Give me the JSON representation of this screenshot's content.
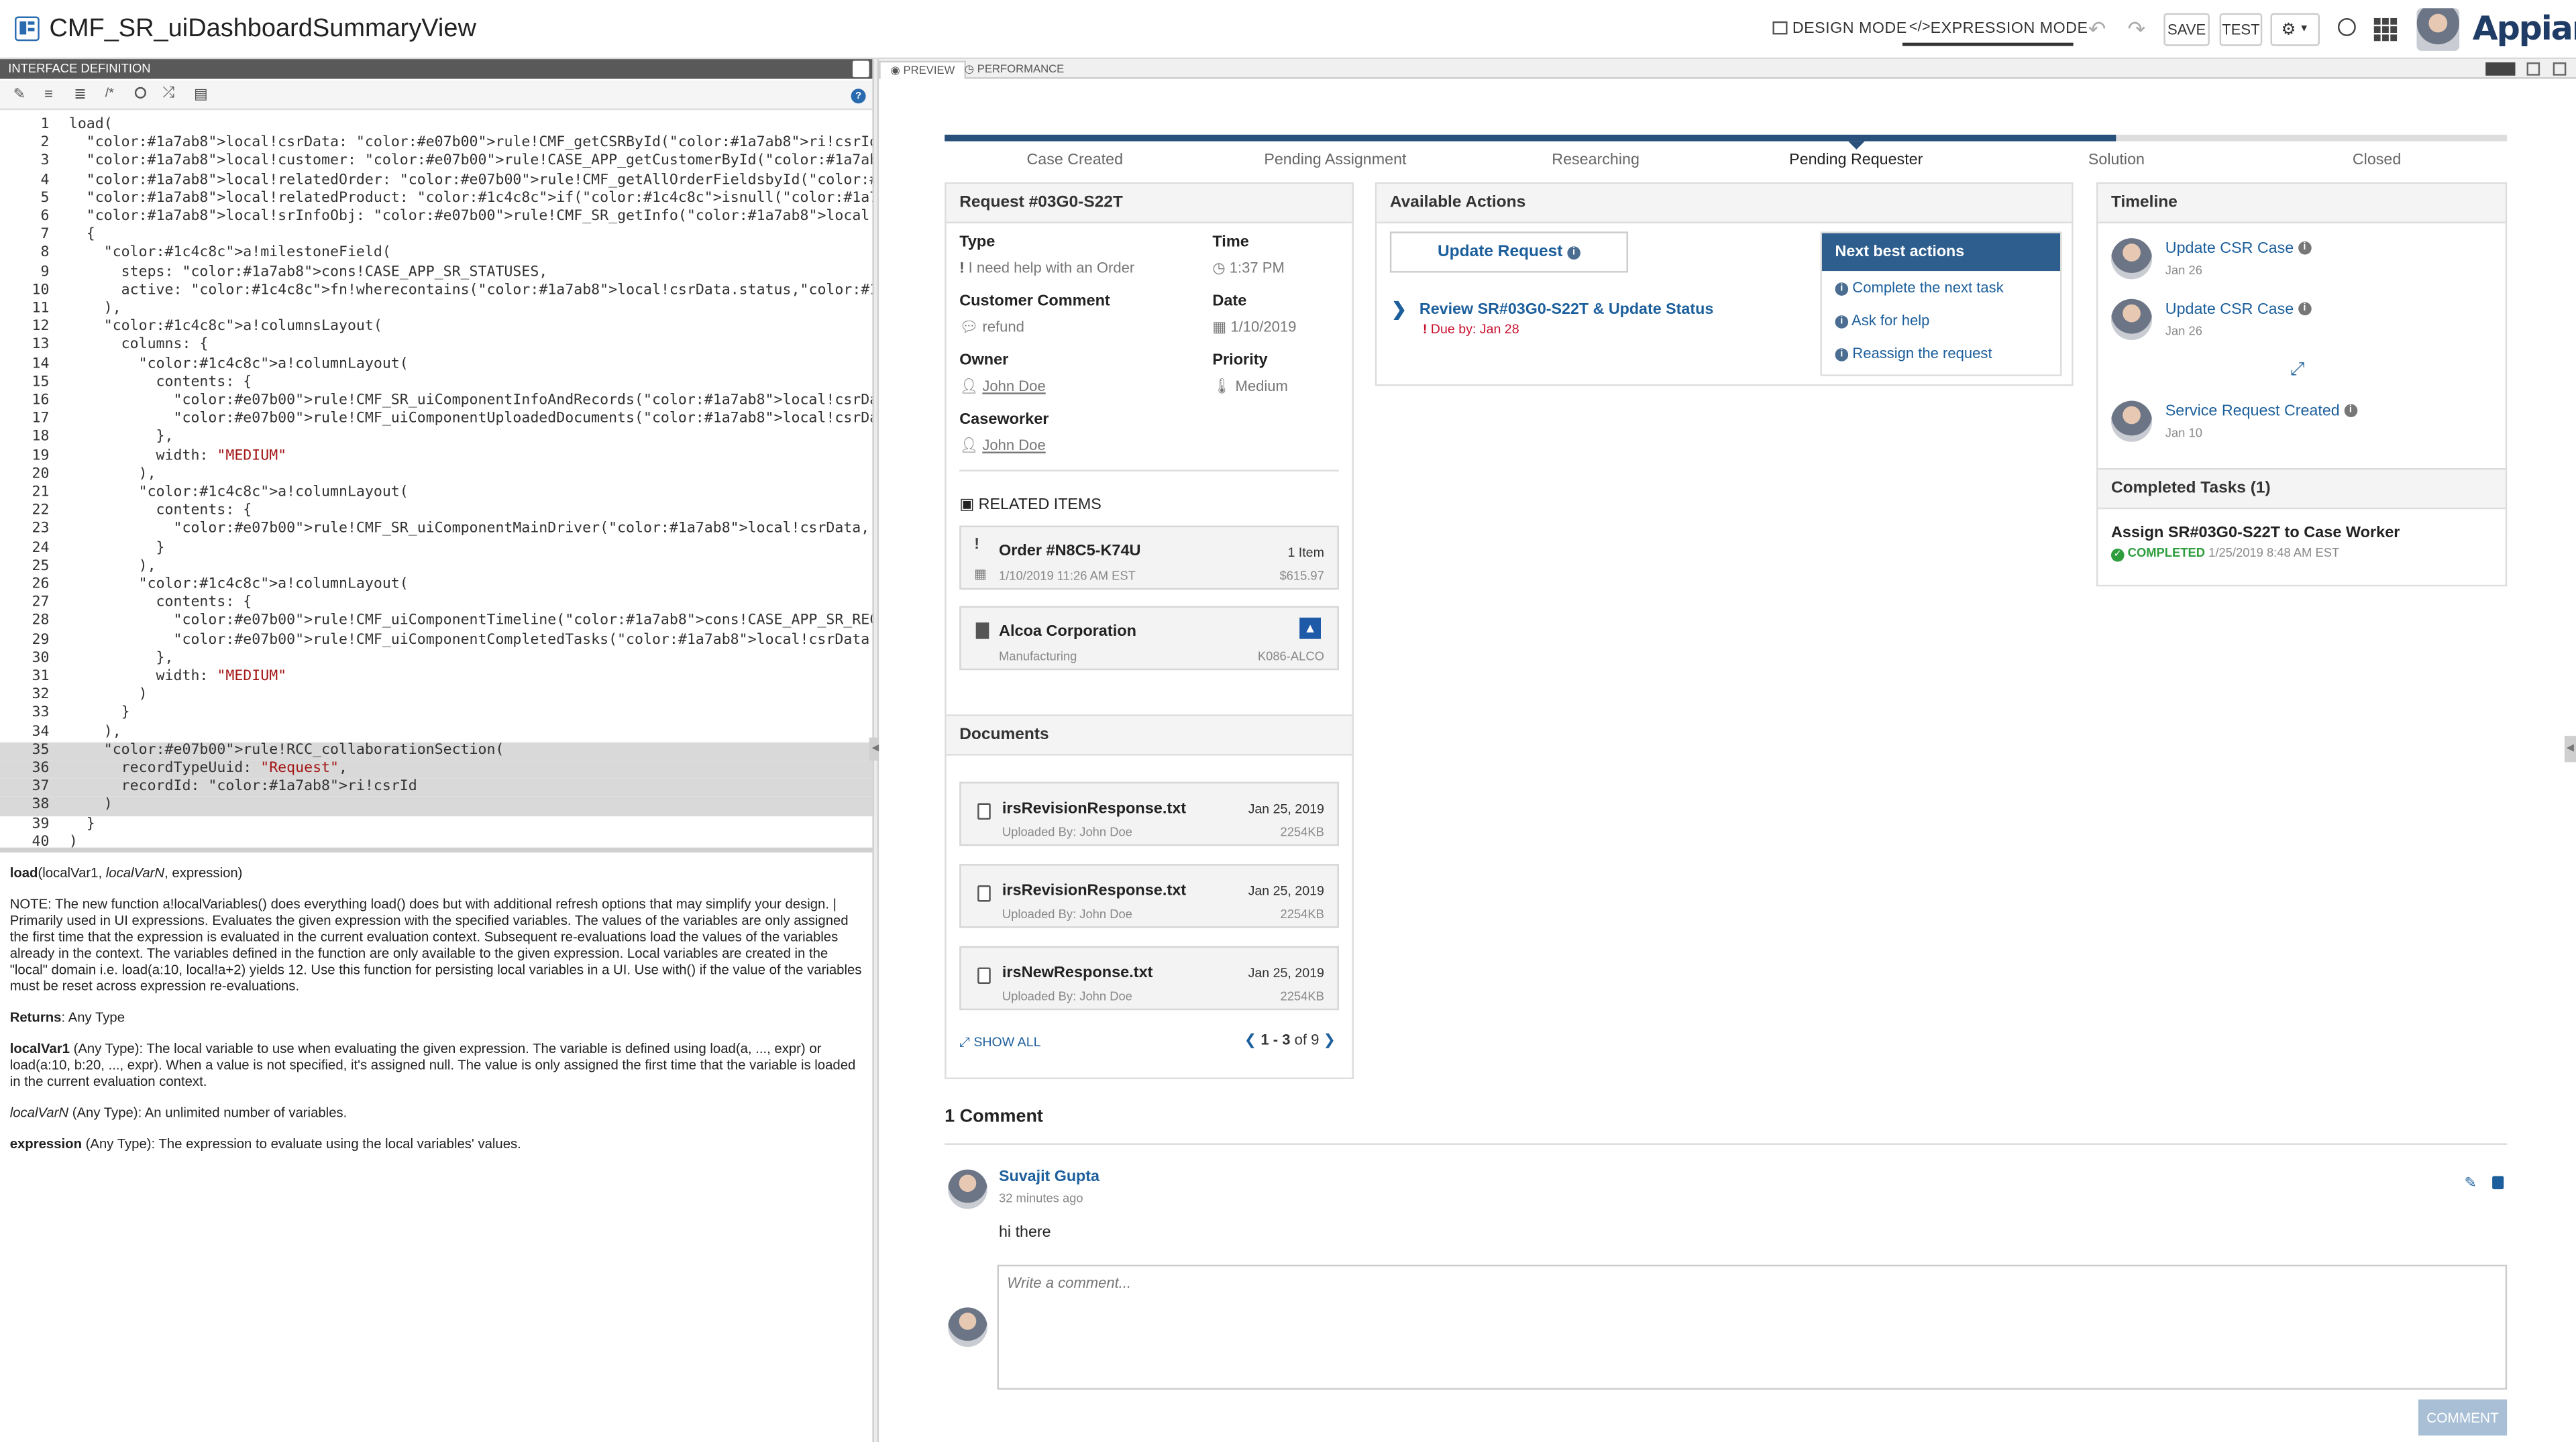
{
  "header": {
    "title": "CMF_SR_uiDashboardSummaryView",
    "design_mode": "DESIGN MODE",
    "expression_mode": "EXPRESSION MODE",
    "save": "SAVE",
    "test": "TEST",
    "logo": "Appian"
  },
  "left": {
    "title": "INTERFACE DEFINITION"
  },
  "code_lines": [
    {
      "n": "1",
      "t": "load("
    },
    {
      "n": "2",
      "t": "  local!csrData: rule!CMF_getCSRById(ri!csrId),"
    },
    {
      "n": "3",
      "t": "  local!customer: rule!CASE_APP_getCustomerById(local!csrData.relatedCustomerId),"
    },
    {
      "n": "4",
      "t": "  local!relatedOrder: rule!CMF_getAllOrderFieldsbyId(local!csrData.relatedOrderItemId),"
    },
    {
      "n": "5",
      "t": "  local!relatedProduct: if(isnull(local!csrData.relatedOrderItemId), null, rule!CMF_getOr"
    },
    {
      "n": "6",
      "t": "  local!srInfoObj: rule!CMF_SR_getInfo(local!csrData, local!customer, local!relatedOrder,"
    },
    {
      "n": "7",
      "t": "  {"
    },
    {
      "n": "8",
      "t": "    a!milestoneField("
    },
    {
      "n": "9",
      "t": "      steps: cons!CASE_APP_SR_STATUSES,"
    },
    {
      "n": "10",
      "t": "      active: fn!wherecontains(local!csrData.status,cons!CASE_APP_SR_STATUSES)"
    },
    {
      "n": "11",
      "t": "    ),"
    },
    {
      "n": "12",
      "t": "    a!columnsLayout("
    },
    {
      "n": "13",
      "t": "      columns: {"
    },
    {
      "n": "14",
      "t": "        a!columnLayout("
    },
    {
      "n": "15",
      "t": "          contents: {"
    },
    {
      "n": "16",
      "t": "            rule!CMF_SR_uiComponentInfoAndRecords(local!csrData,local!customer,local!rel"
    },
    {
      "n": "17",
      "t": "            rule!CMF_uiComponentUploadedDocuments(local!csrData.folderId)"
    },
    {
      "n": "18",
      "t": "          },"
    },
    {
      "n": "19",
      "t": "          width: \"MEDIUM\""
    },
    {
      "n": "20",
      "t": "        ),"
    },
    {
      "n": "21",
      "t": "        a!columnLayout("
    },
    {
      "n": "22",
      "t": "          contents: {"
    },
    {
      "n": "23",
      "t": "            rule!CMF_SR_uiComponentMainDriver(local!csrData, local!srInfoObj)"
    },
    {
      "n": "24",
      "t": "          }"
    },
    {
      "n": "25",
      "t": "        ),"
    },
    {
      "n": "26",
      "t": "        a!columnLayout("
    },
    {
      "n": "27",
      "t": "          contents: {"
    },
    {
      "n": "28",
      "t": "            rule!CMF_uiComponentTimeline(cons!CASE_APP_SR_RECORD_TYPE,local!csrData.id,\""
    },
    {
      "n": "29",
      "t": "            rule!CMF_uiComponentCompletedTasks(local!csrData.processId, local!csrData.id"
    },
    {
      "n": "30",
      "t": "          },"
    },
    {
      "n": "31",
      "t": "          width: \"MEDIUM\""
    },
    {
      "n": "32",
      "t": "        )"
    },
    {
      "n": "33",
      "t": "      }"
    },
    {
      "n": "34",
      "t": "    ),"
    },
    {
      "n": "35",
      "t": "    rule!RCC_collaborationSection("
    },
    {
      "n": "36",
      "t": "      recordTypeUuid: \"Request\","
    },
    {
      "n": "37",
      "t": "      recordId: ri!csrId"
    },
    {
      "n": "38",
      "t": "    )"
    },
    {
      "n": "39",
      "t": "  }"
    },
    {
      "n": "40",
      "t": ")"
    }
  ],
  "doc": {
    "sig_fn": "load",
    "sig_rest": "(localVar1, ",
    "sig_it": "localVarN",
    "sig_end": ", expression)",
    "note": "NOTE: The new function a!localVariables() does everything load() does but with additional refresh options that may simplify your design. | Primarily used in UI expressions. Evaluates the given expression with the specified variables. The values of the variables are only assigned the first time that the expression is evaluated in the current evaluation context. Subsequent re-evaluations load the values of the variables already in the context. The variables defined in the function are only available to the given expression. Local variables are created in the \"local\" domain i.e. load(a:10, local!a+2) yields 12. Use this function for persisting local variables in a UI. Use with() if the value of the variables must be reset across expression re-evaluations.",
    "returns_label": "Returns",
    "returns_val": ": Any Type",
    "p1_name": "localVar1",
    "p1_desc": " (Any Type): The local variable to use when evaluating the given expression. The variable is defined using load(a, ..., expr) or load(a:10, b:20, ..., expr). When a value is not specified, it's assigned null. The value is only assigned the first time that the variable is loaded in the current evaluation context.",
    "p2_name": "localVarN",
    "p2_desc": " (Any Type): An unlimited number of variables.",
    "p3_name": "expression",
    "p3_desc": " (Any Type): The expression to evaluate using the local variables' values."
  },
  "tabs": {
    "preview": "PREVIEW",
    "performance": "PERFORMANCE"
  },
  "milestones": {
    "steps": [
      "Case Created",
      "Pending Assignment",
      "Researching",
      "Pending Requester",
      "Solution",
      "Closed"
    ],
    "active": "Pending Requester",
    "progress": 0.75
  },
  "request": {
    "title": "Request #03G0-S22T",
    "type_label": "Type",
    "type_val": "I need help with an Order",
    "time_label": "Time",
    "time_val": "1:37 PM",
    "comment_label": "Customer Comment",
    "comment_val": "refund",
    "date_label": "Date",
    "date_val": "1/10/2019",
    "owner_label": "Owner",
    "owner_val": "John Doe",
    "priority_label": "Priority",
    "priority_val": "Medium",
    "caseworker_label": "Caseworker",
    "caseworker_val": "John Doe",
    "related_label": "RELATED ITEMS",
    "order_title": "Order #N8C5-K74U",
    "order_date": "1/10/2019 11:26 AM EST",
    "order_items": "1 Item",
    "order_amount": "$615.97",
    "company_name": "Alcoa Corporation",
    "company_industry": "Manufacturing",
    "company_code": "K086-ALCO"
  },
  "documents": {
    "title": "Documents",
    "items": [
      {
        "name": "irsRevisionResponse.txt",
        "date": "Jan 25, 2019",
        "by": "Uploaded By: John Doe",
        "size": "2254KB"
      },
      {
        "name": "irsRevisionResponse.txt",
        "date": "Jan 25, 2019",
        "by": "Uploaded By: John Doe",
        "size": "2254KB"
      },
      {
        "name": "irsNewResponse.txt",
        "date": "Jan 25, 2019",
        "by": "Uploaded By: John Doe",
        "size": "2254KB"
      }
    ],
    "show_all": "SHOW ALL",
    "pager_range": "1 - 3",
    "pager_of": "of 9"
  },
  "actions": {
    "title": "Available Actions",
    "update_button": "Update Request",
    "review_title": "Review SR#03G0-S22T & Update Status",
    "due": "Due by: Jan 28",
    "nba_title": "Next best actions",
    "nba_items": [
      "Complete the next task",
      "Ask for help",
      "Reassign the request"
    ]
  },
  "timeline": {
    "title": "Timeline",
    "items": [
      {
        "title": "Update CSR Case",
        "date": "Jan 26"
      },
      {
        "title": "Update CSR Case",
        "date": "Jan 26"
      },
      {
        "title": "Service Request Created",
        "date": "Jan 10"
      }
    ]
  },
  "completed": {
    "title": "Completed Tasks (1)",
    "task": "Assign SR#03G0-S22T to Case Worker",
    "status": "COMPLETED",
    "date": "1/25/2019 8:48 AM EST"
  },
  "comments": {
    "count_label": "1 Comment",
    "author": "Suvajit Gupta",
    "ago": "32 minutes ago",
    "text": "hi there",
    "placeholder": "Write a comment...",
    "button": "COMMENT"
  },
  "colors": {
    "accent": "#1c5f9c",
    "dark_header": "#595959",
    "nba_header": "#2e5e8e",
    "comment_button": "#a8bfd6",
    "due_red": "#c8102e",
    "completed_green": "#2e9d3e"
  }
}
